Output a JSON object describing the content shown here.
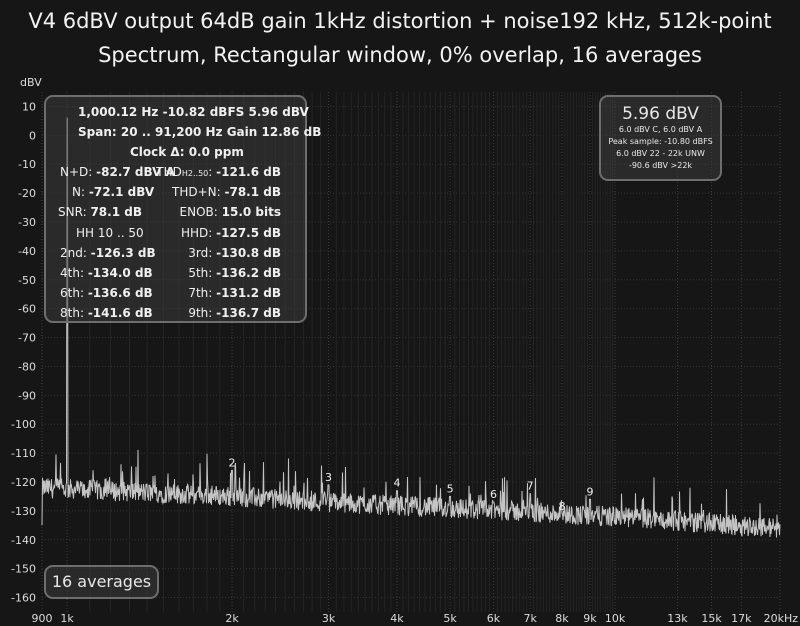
{
  "title_line1": "V4 6dBV output 64dB gain 1kHz distortion + noise192 kHz, 512k-point",
  "title_line2": "Spectrum, Rectangular window, 0% overlap, 16 averages",
  "stats": {
    "line1": "1,000.12 Hz  -10.82 dBFS  5.96 dBV",
    "line2": "Span: 20 .. 91,200 Hz  Gain 12.86 dB",
    "clock": "Clock Δ: 0.0 ppm",
    "rows": [
      {
        "l1": "N+D:",
        "v1": "-82.7 dBV A",
        "l2": "THD",
        "sub": "H2..50",
        "l2b": ":",
        "v2": "-121.6 dB"
      },
      {
        "l1": "N:",
        "v1": "-72.1 dBV",
        "l2": "THD+N:",
        "sub": "",
        "l2b": "",
        "v2": "-78.1 dB"
      },
      {
        "l1": "SNR:",
        "v1": "78.1 dB",
        "l2": "ENOB:",
        "sub": "",
        "l2b": "",
        "v2": "15.0 bits"
      },
      {
        "l1": "HH 10 .. 50",
        "v1": "",
        "l2": "HHD:",
        "sub": "",
        "l2b": "",
        "v2": "-127.5 dB"
      },
      {
        "l1": "2nd:",
        "v1": "-126.3 dB",
        "l2": "3rd:",
        "sub": "",
        "l2b": "",
        "v2": "-130.8 dB"
      },
      {
        "l1": "4th:",
        "v1": "-134.0 dB",
        "l2": "5th:",
        "sub": "",
        "l2b": "",
        "v2": "-136.2 dB"
      },
      {
        "l1": "6th:",
        "v1": "-136.6 dB",
        "l2": "7th:",
        "sub": "",
        "l2b": "",
        "v2": "-131.2 dB"
      },
      {
        "l1": "8th:",
        "v1": "-141.6 dB",
        "l2": "9th:",
        "sub": "",
        "l2b": "",
        "v2": "-136.7 dB"
      }
    ]
  },
  "peak_box": {
    "value": "5.96 dBV",
    "lines": [
      "6.0 dBV C, 6.0 dBV A",
      "Peak sample: -10.80 dBFS",
      "6.0 dBV 22 - 22k UNW",
      "-90.6 dBV >22k"
    ]
  },
  "averages_label": "16 averages",
  "colors": {
    "background": "#161616",
    "trace": "#c4c4c4",
    "grid": "#3a3a3a",
    "panel_border": "#6e6e6e"
  },
  "chart_data": {
    "type": "line",
    "title": "V4 6dBV output 64dB gain 1kHz distortion + noise192 kHz, 512k-point",
    "subtitle": "Spectrum, Rectangular window, 0% overlap, 16 averages",
    "ylabel": "dBV",
    "xlabel": "",
    "x_scale": "log",
    "xlim": [
      900,
      20000
    ],
    "ylim": [
      -165,
      15
    ],
    "grid": true,
    "y_ticks": [
      10,
      0,
      -10,
      -20,
      -30,
      -40,
      -50,
      -60,
      -70,
      -80,
      -90,
      -100,
      -110,
      -120,
      -130,
      -140,
      -150,
      -160
    ],
    "x_ticks": [
      {
        "value": 900,
        "label": "900"
      },
      {
        "value": 1000,
        "label": "1k"
      },
      {
        "value": 2000,
        "label": "2k"
      },
      {
        "value": 3000,
        "label": "3k"
      },
      {
        "value": 4000,
        "label": "4k"
      },
      {
        "value": 5000,
        "label": "5k"
      },
      {
        "value": 6000,
        "label": "6k"
      },
      {
        "value": 7000,
        "label": "7k"
      },
      {
        "value": 8000,
        "label": "8k"
      },
      {
        "value": 9000,
        "label": "9k"
      },
      {
        "value": 10000,
        "label": "10k"
      },
      {
        "value": 13000,
        "label": "13k"
      },
      {
        "value": 15000,
        "label": "15k"
      },
      {
        "value": 17000,
        "label": "17k"
      },
      {
        "value": 20000,
        "label": "20kHz"
      }
    ],
    "fundamental": {
      "freq": 1000.12,
      "level": 5.96
    },
    "noise_floor": [
      {
        "freq": 900,
        "level": -122
      },
      {
        "freq": 2000,
        "level": -125
      },
      {
        "freq": 3000,
        "level": -127
      },
      {
        "freq": 5000,
        "level": -129
      },
      {
        "freq": 10000,
        "level": -132
      },
      {
        "freq": 20000,
        "level": -136
      }
    ],
    "harmonics": [
      {
        "label": "2",
        "freq": 2000,
        "level": -116
      },
      {
        "label": "3",
        "freq": 3000,
        "level": -121
      },
      {
        "label": "4",
        "freq": 4000,
        "level": -123
      },
      {
        "label": "5",
        "freq": 5000,
        "level": -125
      },
      {
        "label": "6",
        "freq": 6000,
        "level": -127
      },
      {
        "label": "7",
        "freq": 7000,
        "level": -124
      },
      {
        "label": "8",
        "freq": 8000,
        "level": -131
      },
      {
        "label": "9",
        "freq": 9000,
        "level": -126
      }
    ]
  }
}
